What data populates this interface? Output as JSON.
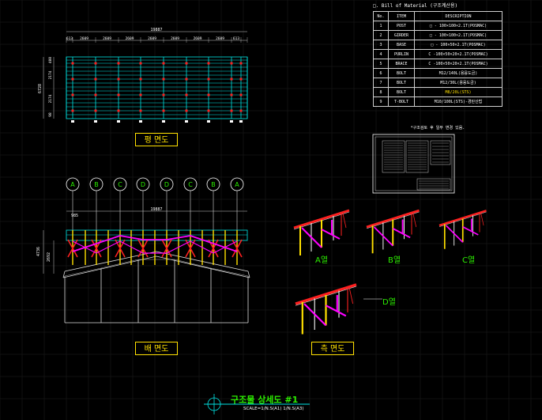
{
  "bom": {
    "title": "□. Bill of Material (구조계산용)",
    "headers": [
      "No.",
      "ITEM",
      "DESCRIPTION"
    ],
    "rows": [
      {
        "no": "1",
        "item": "POST",
        "desc": "□ - 100×100×2.1T(POSMAC)",
        "highlight": false
      },
      {
        "no": "2",
        "item": "GIRDER",
        "desc": "□ - 100×100×2.1T(POSMAC)",
        "highlight": false
      },
      {
        "no": "3",
        "item": "BASE",
        "desc": "□ - 100×50×2.1T(POSMAC)",
        "highlight": false
      },
      {
        "no": "4",
        "item": "PURLIN",
        "desc": "C -100×50×20×2.1T(POSMAC)",
        "highlight": false
      },
      {
        "no": "5",
        "item": "BRACE",
        "desc": "C -100×50×20×2.1T(POSMAC)",
        "highlight": false
      },
      {
        "no": "6",
        "item": "BOLT",
        "desc": "M12/140L(용융도금)",
        "highlight": false
      },
      {
        "no": "7",
        "item": "BOLT",
        "desc": "M12/30L(용융도금)",
        "highlight": false
      },
      {
        "no": "8",
        "item": "BOLT",
        "desc": "M8/20L(STS)",
        "highlight": true
      },
      {
        "no": "9",
        "item": "T-BOLT",
        "desc": "M10/100L(STS)-경탄산법",
        "highlight": false
      }
    ],
    "note": "*구조검토 후 일부 변경 있음."
  },
  "plan": {
    "overall": "19887",
    "spans": [
      "613",
      "2609",
      "2609",
      "2609",
      "2609",
      "2609",
      "2609",
      "2609",
      "613"
    ],
    "depth_total": "6728",
    "depth_parts": [
      "400",
      "2174",
      "2174",
      "98"
    ],
    "label_a": "평",
    "label_b": "면도"
  },
  "elevation": {
    "overall": "19887",
    "left_dim": "985",
    "height_total": "4736",
    "height_part": "2692",
    "rows": [
      "A",
      "B",
      "C",
      "D",
      "D",
      "C",
      "B",
      "A"
    ],
    "label_a": "배",
    "label_b": "면도"
  },
  "sections": {
    "a": "A열",
    "b": "B열",
    "c": "C열",
    "d": "D열",
    "label_a": "측",
    "label_b": "면도"
  },
  "title": {
    "main": "구조물 상세도 #1",
    "scale": "SCALE=1/N.S(A1) 1/N.S(A3)"
  },
  "colors": {
    "background": "#000000",
    "grid": "#1f1f1f",
    "purlin": "#00e5e5",
    "post": "#ff2020",
    "brace": "#ff00ff",
    "base": "#ffe000",
    "label": "#2cf000"
  }
}
